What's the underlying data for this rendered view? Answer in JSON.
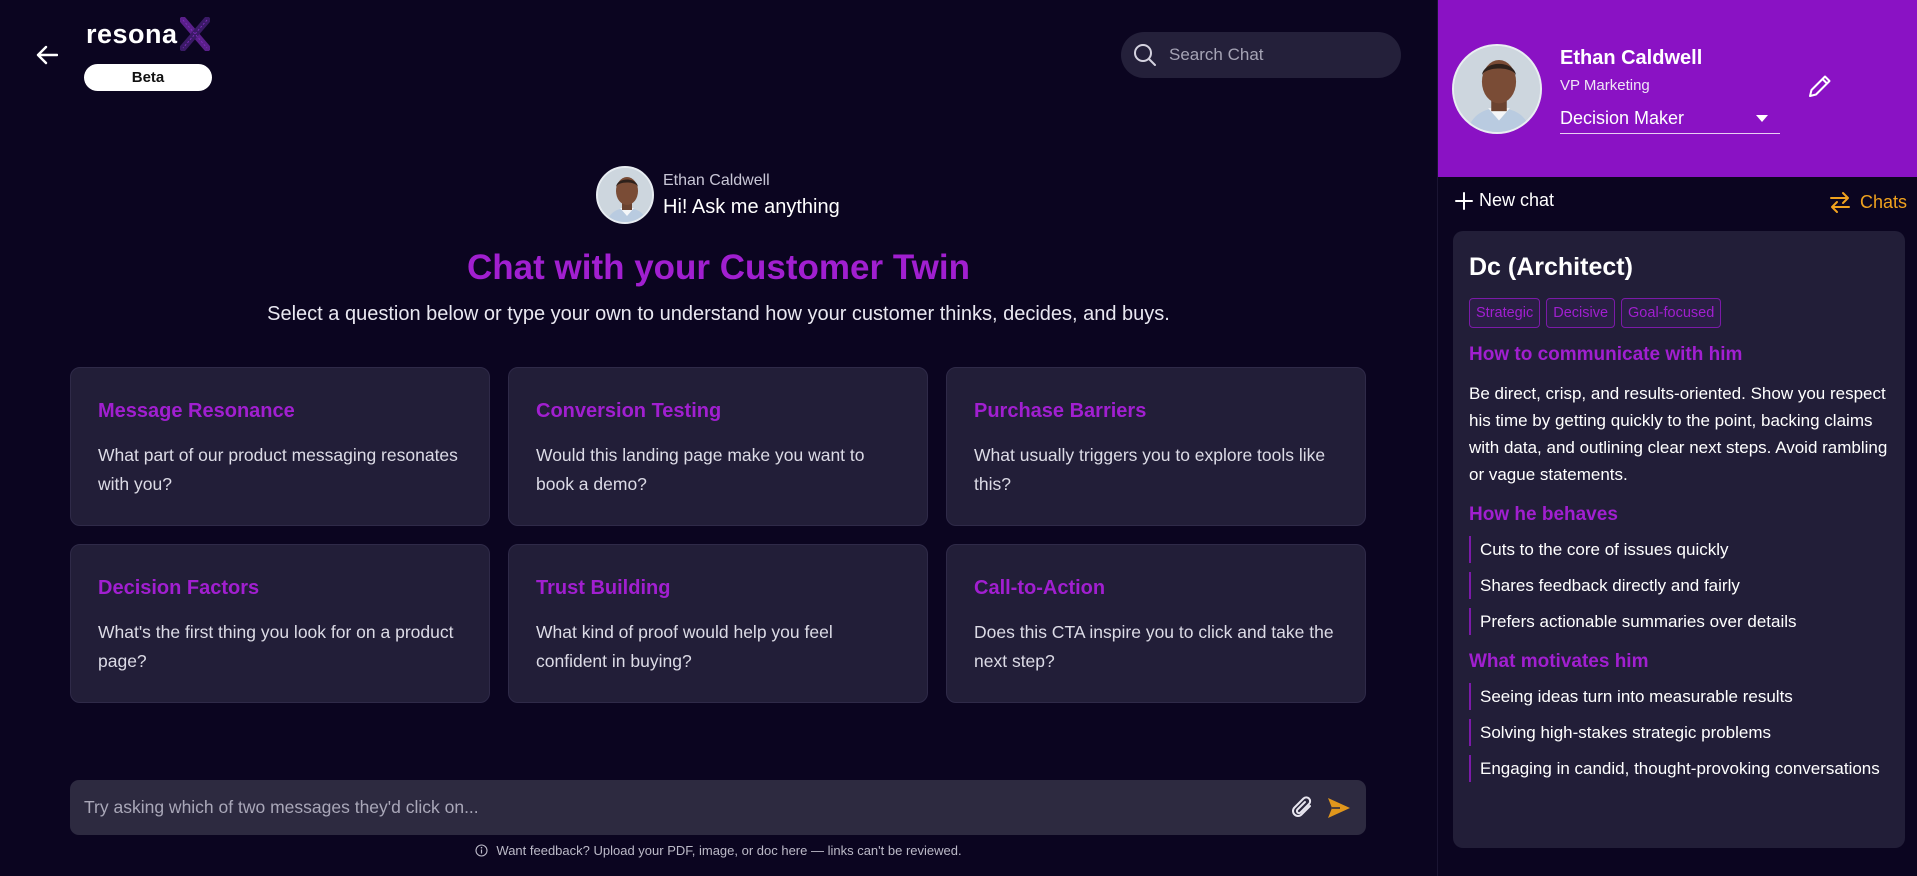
{
  "header": {
    "brand": "resona",
    "badge": "Beta",
    "search_placeholder": "Search Chat"
  },
  "greeting": {
    "name": "Ethan Caldwell",
    "message": "Hi! Ask me anything"
  },
  "hero": {
    "title": "Chat with your Customer Twin",
    "subtitle": "Select a question below or type your own to understand how your customer thinks, decides, and buys."
  },
  "cards": [
    {
      "title": "Message Resonance",
      "text": "What part of our product messaging resonates with you?"
    },
    {
      "title": "Conversion Testing",
      "text": "Would this landing page make you want to book a demo?"
    },
    {
      "title": "Purchase Barriers",
      "text": "What usually triggers you to explore tools like this?"
    },
    {
      "title": "Decision Factors",
      "text": "What's the first thing you look for on a product page?"
    },
    {
      "title": "Trust Building",
      "text": "What kind of proof would help you feel confident in buying?"
    },
    {
      "title": "Call-to-Action",
      "text": "Does this CTA inspire you to click and take the next step?"
    }
  ],
  "composer": {
    "placeholder": "Try asking which of two messages they'd click on...",
    "footnote": "Want feedback? Upload your PDF, image, or doc here — links can't be reviewed."
  },
  "profile": {
    "name": "Ethan Caldwell",
    "role": "VP Marketing",
    "persona_selected": "Decision Maker"
  },
  "toolbar": {
    "new_chat": "New chat",
    "chats": "Chats"
  },
  "persona": {
    "title": "Dc (Architect)",
    "tags": [
      "Strategic",
      "Decisive",
      "Goal-focused"
    ],
    "communicate_heading": "How to communicate with him",
    "communicate_text": "Be direct, crisp, and results-oriented. Show you respect his time by getting quickly to the point, backing claims with data, and outlining clear next steps. Avoid rambling or vague statements.",
    "behaves_heading": "How he behaves",
    "behaves": [
      "Cuts to the core of issues quickly",
      "Shares feedback directly and fairly",
      "Prefers actionable summaries over details"
    ],
    "motivates_heading": "What motivates him",
    "motivates": [
      "Seeing ideas turn into measurable results",
      "Solving high-stakes strategic problems",
      "Engaging in candid, thought-provoking conversations"
    ]
  },
  "colors": {
    "background": "#0b0520",
    "accent_purple": "#a11fd0",
    "profile_bg": "#8a12c4",
    "card_bg": "#221e38",
    "chats_orange": "#f0a21e"
  },
  "icons": {
    "back": "arrow-left-icon",
    "search": "search-icon",
    "attach": "paperclip-icon",
    "send": "send-icon",
    "edit": "pencil-icon",
    "plus": "plus-icon",
    "swap": "arrows-swap-icon",
    "info": "info-icon"
  }
}
